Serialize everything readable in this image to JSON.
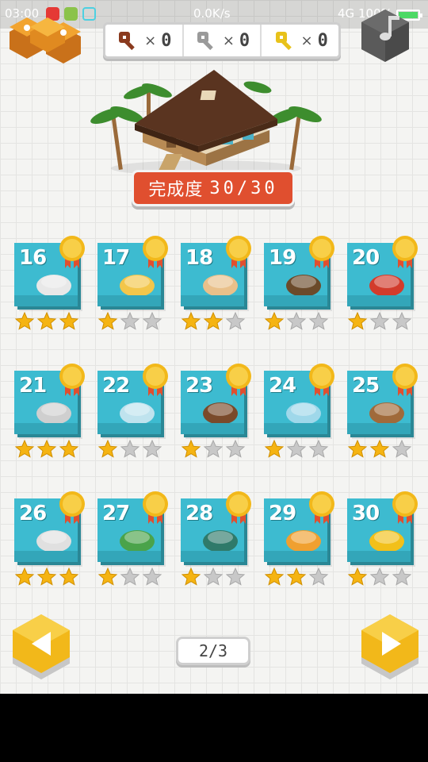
{
  "status_bar": {
    "time": "03:00",
    "speed": "0.0K/s",
    "network": "4G",
    "battery": "100%"
  },
  "keys": [
    {
      "name": "bronze-key",
      "color": "#8a3a1e",
      "count": "0"
    },
    {
      "name": "silver-key",
      "color": "#9a9a9a",
      "count": "0"
    },
    {
      "name": "gold-key",
      "color": "#e8c21a",
      "count": "0"
    }
  ],
  "keys_times": "×",
  "completion": {
    "label": "完成度",
    "value": "30/30"
  },
  "levels": [
    {
      "number": "16",
      "stars": 3
    },
    {
      "number": "17",
      "stars": 1
    },
    {
      "number": "18",
      "stars": 2
    },
    {
      "number": "19",
      "stars": 1
    },
    {
      "number": "20",
      "stars": 1
    },
    {
      "number": "21",
      "stars": 3
    },
    {
      "number": "22",
      "stars": 1
    },
    {
      "number": "23",
      "stars": 1
    },
    {
      "number": "24",
      "stars": 1
    },
    {
      "number": "25",
      "stars": 2
    },
    {
      "number": "26",
      "stars": 3
    },
    {
      "number": "27",
      "stars": 1
    },
    {
      "number": "28",
      "stars": 1
    },
    {
      "number": "29",
      "stars": 2
    },
    {
      "number": "30",
      "stars": 1
    }
  ],
  "max_stars": 3,
  "page": "2/3",
  "colors": {
    "accent": "#f2b81a",
    "card": "#3dbbd0",
    "banner": "#e04f2f",
    "star_on": "#f5b412",
    "star_off": "#c8c8c8"
  }
}
